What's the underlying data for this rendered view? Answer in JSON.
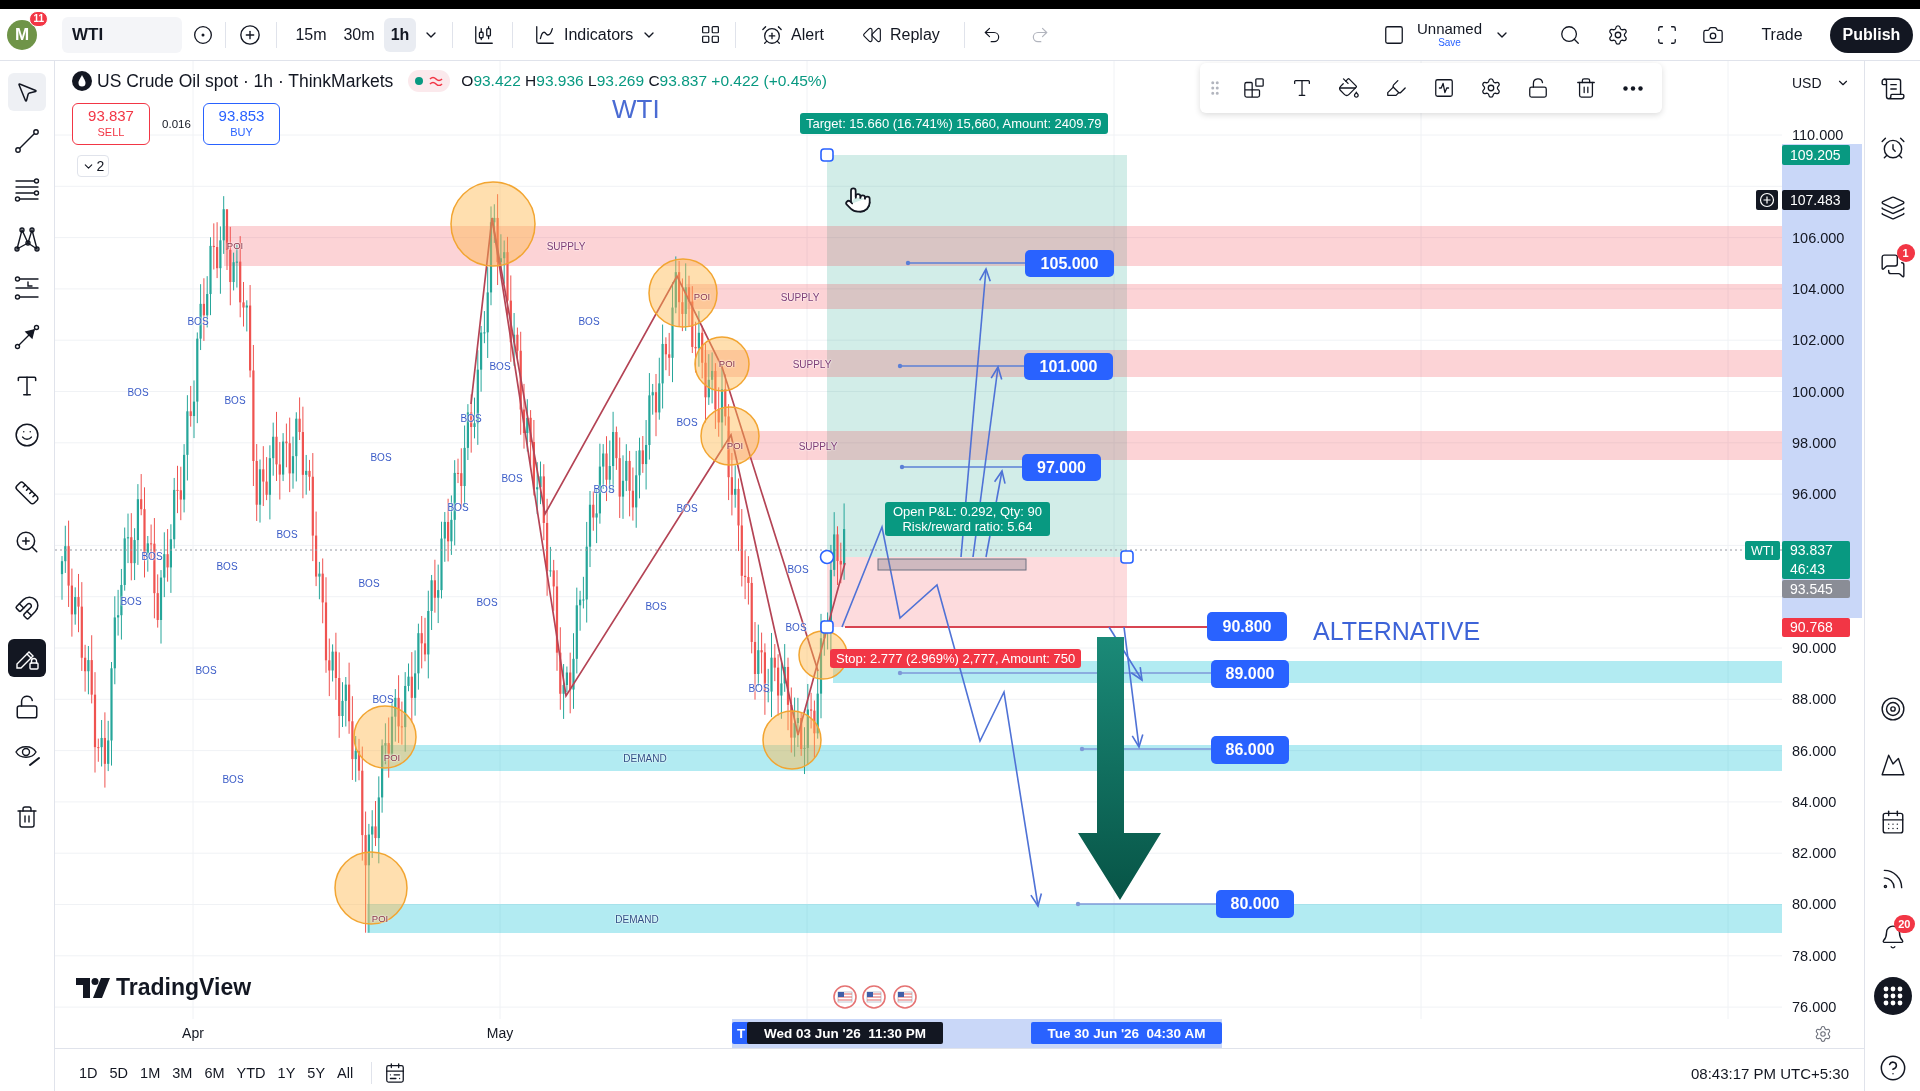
{
  "top_toolbar": {
    "avatar": {
      "letter": "M",
      "badge": "11"
    },
    "symbol": "WTI",
    "intervals": [
      {
        "label": "15m",
        "selected": false
      },
      {
        "label": "30m",
        "selected": false
      },
      {
        "label": "1h",
        "selected": true
      }
    ],
    "indicators": "Indicators",
    "alert": "Alert",
    "replay": "Replay",
    "layout": {
      "name": "Unnamed",
      "status": "Save"
    },
    "trade": "Trade",
    "publish": "Publish"
  },
  "left_toolbar": {
    "tools": [
      {
        "selected": true
      },
      {
        "selected": false
      },
      {
        "selected": false
      },
      {
        "selected": false
      },
      {
        "selected": false
      },
      {
        "selected": false
      },
      {
        "selected": false
      },
      {
        "selected": false
      },
      {
        "selected": false
      },
      {
        "selected": false
      }
    ],
    "toggles": [
      {
        "on": false
      },
      {
        "on": true
      },
      {
        "on": false
      },
      {
        "on": false
      }
    ]
  },
  "legend": {
    "title": "US Crude Oil spot · 1h · ThinkMarkets",
    "ohlc": [
      {
        "label": "O",
        "value": "93.422"
      },
      {
        "label": "H",
        "value": "93.936"
      },
      {
        "label": "L",
        "value": "93.269"
      },
      {
        "label": "C",
        "value": "93.837"
      }
    ],
    "change": "+0.422 (+0.45%)",
    "sell": {
      "price": "93.837",
      "label": "SELL"
    },
    "spread": "0.016",
    "buy": {
      "price": "93.853",
      "label": "BUY"
    },
    "collapsed_count": "2"
  },
  "chart": {
    "title": "WTI",
    "note": "ALTERNATIVE",
    "zones": [
      {
        "kind": "supply",
        "label": "SUPPLY",
        "poi": "POI"
      },
      {
        "kind": "supply",
        "label": "SUPPLY",
        "poi": "POI"
      },
      {
        "kind": "supply",
        "label": "SUPPLY",
        "poi": "POI"
      },
      {
        "kind": "supply",
        "label": "SUPPLY",
        "poi": "POI"
      },
      {
        "kind": "demand"
      },
      {
        "kind": "demand",
        "label": "DEMAND",
        "poi": "POI"
      },
      {
        "kind": "demand",
        "label": "DEMAND",
        "poi": "POI"
      }
    ],
    "bos_labels": [
      "BOS",
      "BOS",
      "BOS",
      "BOS",
      "BOS",
      "BOS",
      "BOS",
      "BOS",
      "BOS",
      "BOS",
      "BOS",
      "BOS",
      "BOS",
      "BOS",
      "BOS",
      "BOS",
      "BOS",
      "BOS",
      "BOS",
      "BOS",
      "BOS",
      "BOS",
      "BOS",
      "BOS",
      "BOS"
    ],
    "position": {
      "target": "Target: 15.660 (16.741%) 15,660, Amount: 2409.79",
      "pnl": "Open P&L: 0.292, Qty: 90",
      "ratio": "Risk/reward ratio: 5.64",
      "stop": "Stop: 2.777 (2.969%) 2,777, Amount: 750"
    },
    "price_marks": [
      {
        "kind": "target",
        "value": "105.000"
      },
      {
        "kind": "target",
        "value": "101.000"
      },
      {
        "kind": "target",
        "value": "97.000"
      },
      {
        "kind": "stop",
        "value": "90.800"
      },
      {
        "kind": "support",
        "value": "89.000"
      },
      {
        "kind": "support",
        "value": "86.000"
      },
      {
        "kind": "support",
        "value": "80.000"
      }
    ],
    "logo": "TradingView"
  },
  "price_axis": {
    "currency": "USD",
    "ticks": [
      "110.000",
      "106.000",
      "104.000",
      "102.000",
      "100.000",
      "98.000",
      "96.000",
      "90.000",
      "88.000",
      "86.000",
      "84.000",
      "82.000",
      "80.000",
      "78.000",
      "76.000"
    ],
    "labels": [
      {
        "kind": "high",
        "value": "109.205"
      },
      {
        "kind": "crosshair",
        "value": "107.483"
      },
      {
        "kind": "last",
        "symbol": "WTI",
        "value": "93.837",
        "countdown": "46:43"
      },
      {
        "kind": "level",
        "value": "93.545"
      },
      {
        "kind": "low",
        "value": "90.768"
      }
    ]
  },
  "time_axis": {
    "ticks": [
      "Apr",
      "May"
    ],
    "range_marker": "T",
    "range_start": "Wed 03 Jun '26  11:30 PM",
    "range_end": "Tue 30 Jun '26  04:30 AM"
  },
  "bottom_bar": {
    "ranges": [
      "1D",
      "5D",
      "1M",
      "3M",
      "6M",
      "YTD",
      "1Y",
      "5Y",
      "All"
    ],
    "clock": "08:43:17 PM UTC+5:30"
  },
  "right_sidebar": {
    "chat_badge": "1",
    "alerts_badge": "20"
  }
}
